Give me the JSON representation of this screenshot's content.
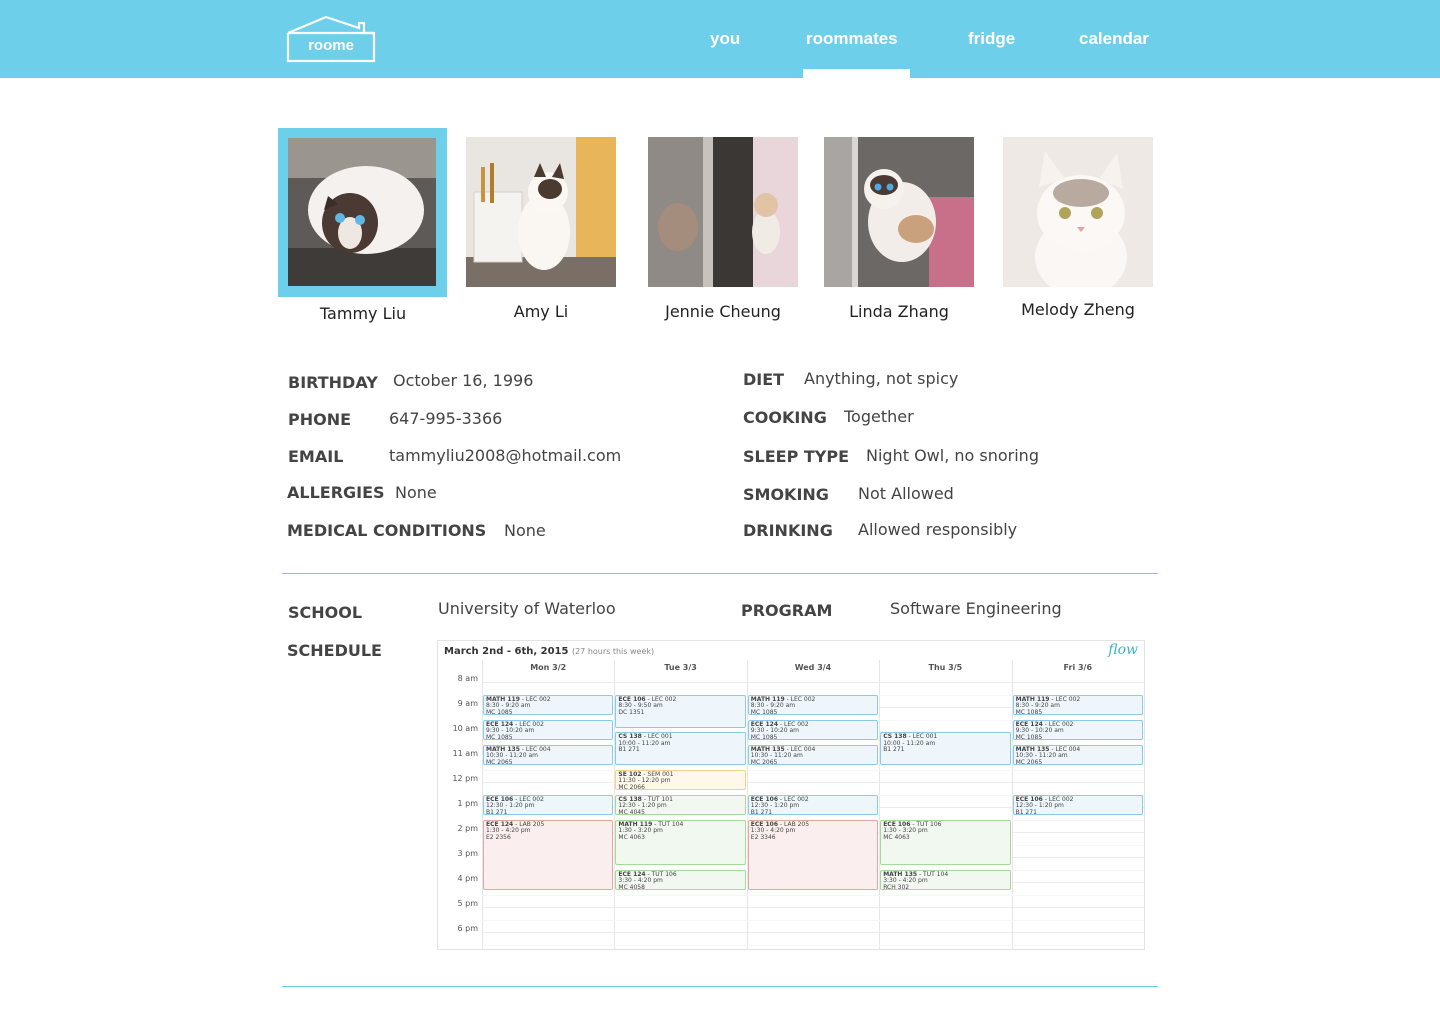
{
  "header": {
    "logo": "roome",
    "nav": [
      "you",
      "roommates",
      "fridge",
      "calendar"
    ],
    "active": "roommates"
  },
  "roommates": [
    {
      "name": "Tammy Liu",
      "selected": true
    },
    {
      "name": "Amy Li",
      "selected": false
    },
    {
      "name": "Jennie Cheung",
      "selected": false
    },
    {
      "name": "Linda Zhang",
      "selected": false
    },
    {
      "name": "Melody Zheng",
      "selected": false
    }
  ],
  "profile": {
    "left": [
      {
        "label": "BIRTHDAY",
        "value": "October 16, 1996"
      },
      {
        "label": "PHONE",
        "value": "647-995-3366"
      },
      {
        "label": "EMAIL",
        "value": "tammyliu2008@hotmail.com"
      },
      {
        "label": "ALLERGIES",
        "value": "None"
      },
      {
        "label": "MEDICAL CONDITIONS",
        "value": "None"
      }
    ],
    "right": [
      {
        "label": "DIET",
        "value": "Anything, not spicy"
      },
      {
        "label": "COOKING",
        "value": "Together"
      },
      {
        "label": "SLEEP TYPE",
        "value": "Night Owl, no snoring"
      },
      {
        "label": "SMOKING",
        "value": "Not Allowed"
      },
      {
        "label": "DRINKING",
        "value": "Allowed responsibly"
      }
    ]
  },
  "education": {
    "school_label": "SCHOOL",
    "school": "University of Waterloo",
    "program_label": "PROGRAM",
    "program": "Software Engineering",
    "schedule_label": "SCHEDULE"
  },
  "schedule": {
    "title": "March 2nd - 6th, 2015",
    "hours_note": "(27 hours this week)",
    "brand": "flow",
    "days": [
      "Mon 3/2",
      "Tue 3/3",
      "Wed 3/4",
      "Thu 3/5",
      "Fri 3/6"
    ],
    "hours": [
      "8 am",
      "9 am",
      "10 am",
      "11 am",
      "12 pm",
      "1 pm",
      "2 pm",
      "3 pm",
      "4 pm",
      "5 pm",
      "6 pm"
    ],
    "events": [
      {
        "day": 0,
        "start": 8.5,
        "end": 9.33,
        "code": "MATH 119",
        "sec": " - LEC 002",
        "time": "8:30 - 9:20 am",
        "room": "MC 1085",
        "color": "blue"
      },
      {
        "day": 0,
        "start": 9.5,
        "end": 10.33,
        "code": "ECE 124",
        "sec": " - LEC 002",
        "time": "9:30 - 10:20 am",
        "room": "MC 1085",
        "color": "blue"
      },
      {
        "day": 0,
        "start": 10.5,
        "end": 11.33,
        "code": "MATH 135",
        "sec": " - LEC 004",
        "time": "10:30 - 11:20 am",
        "room": "MC 2065",
        "color": "blue"
      },
      {
        "day": 0,
        "start": 12.5,
        "end": 13.33,
        "code": "ECE 106",
        "sec": " - LEC 002",
        "time": "12:30 - 1:20 pm",
        "room": "B1 271",
        "color": "blue"
      },
      {
        "day": 0,
        "start": 13.5,
        "end": 16.33,
        "code": "ECE 124",
        "sec": " - LAB 205",
        "time": "1:30 - 4:20 pm",
        "room": "E2 2356",
        "color": "red"
      },
      {
        "day": 1,
        "start": 8.5,
        "end": 9.83,
        "code": "ECE 106",
        "sec": " - LEC 002",
        "time": "8:30 - 9:50 am",
        "room": "DC 1351",
        "color": "blue"
      },
      {
        "day": 1,
        "start": 10.0,
        "end": 11.33,
        "code": "CS 138",
        "sec": " - LEC 001",
        "time": "10:00 - 11:20 am",
        "room": "B1 271",
        "color": "blue"
      },
      {
        "day": 1,
        "start": 11.5,
        "end": 12.33,
        "code": "SE 102",
        "sec": " - SEM 001",
        "time": "11:30 - 12:20 pm",
        "room": "MC 2066",
        "color": "yellow"
      },
      {
        "day": 1,
        "start": 12.5,
        "end": 13.33,
        "code": "CS 138",
        "sec": " - TUT 101",
        "time": "12:30 - 1:20 pm",
        "room": "MC 4045",
        "color": "green"
      },
      {
        "day": 1,
        "start": 13.5,
        "end": 15.33,
        "code": "MATH 119",
        "sec": " - TUT 104",
        "time": "1:30 - 3:20 pm",
        "room": "MC 4063",
        "color": "green"
      },
      {
        "day": 1,
        "start": 15.5,
        "end": 16.33,
        "code": "ECE 124",
        "sec": " - TUT 106",
        "time": "3:30 - 4:20 pm",
        "room": "MC 4058",
        "color": "green"
      },
      {
        "day": 2,
        "start": 8.5,
        "end": 9.33,
        "code": "MATH 119",
        "sec": " - LEC 002",
        "time": "8:30 - 9:20 am",
        "room": "MC 1085",
        "color": "blue"
      },
      {
        "day": 2,
        "start": 9.5,
        "end": 10.33,
        "code": "ECE 124",
        "sec": " - LEC 002",
        "time": "9:30 - 10:20 am",
        "room": "MC 1085",
        "color": "blue"
      },
      {
        "day": 2,
        "start": 10.5,
        "end": 11.33,
        "code": "MATH 135",
        "sec": " - LEC 004",
        "time": "10:30 - 11:20 am",
        "room": "MC 2065",
        "color": "blue"
      },
      {
        "day": 2,
        "start": 12.5,
        "end": 13.33,
        "code": "ECE 106",
        "sec": " - LEC 002",
        "time": "12:30 - 1:20 pm",
        "room": "B1 271",
        "color": "blue"
      },
      {
        "day": 2,
        "start": 13.5,
        "end": 16.33,
        "code": "ECE 106",
        "sec": " - LAB 205",
        "time": "1:30 - 4:20 pm",
        "room": "E2 3346",
        "color": "red"
      },
      {
        "day": 3,
        "start": 10.0,
        "end": 11.33,
        "code": "CS 138",
        "sec": " - LEC 001",
        "time": "10:00 - 11:20 am",
        "room": "B1 271",
        "color": "blue"
      },
      {
        "day": 3,
        "start": 13.5,
        "end": 15.33,
        "code": "ECE 106",
        "sec": " - TUT 106",
        "time": "1:30 - 3:20 pm",
        "room": "MC 4063",
        "color": "green"
      },
      {
        "day": 3,
        "start": 15.5,
        "end": 16.33,
        "code": "MATH 135",
        "sec": " - TUT 104",
        "time": "3:30 - 4:20 pm",
        "room": "RCH 302",
        "color": "green"
      },
      {
        "day": 4,
        "start": 8.5,
        "end": 9.33,
        "code": "MATH 119",
        "sec": " - LEC 002",
        "time": "8:30 - 9:20 am",
        "room": "MC 1085",
        "color": "blue"
      },
      {
        "day": 4,
        "start": 9.5,
        "end": 10.33,
        "code": "ECE 124",
        "sec": " - LEC 002",
        "time": "9:30 - 10:20 am",
        "room": "MC 1085",
        "color": "blue"
      },
      {
        "day": 4,
        "start": 10.5,
        "end": 11.33,
        "code": "MATH 135",
        "sec": " - LEC 004",
        "time": "10:30 - 11:20 am",
        "room": "MC 2065",
        "color": "blue"
      },
      {
        "day": 4,
        "start": 12.5,
        "end": 13.33,
        "code": "ECE 106",
        "sec": " - LEC 002",
        "time": "12:30 - 1:20 pm",
        "room": "B1 271",
        "color": "blue"
      }
    ]
  },
  "colors": {
    "accent": "#6ecfeb",
    "text": "#444444"
  }
}
